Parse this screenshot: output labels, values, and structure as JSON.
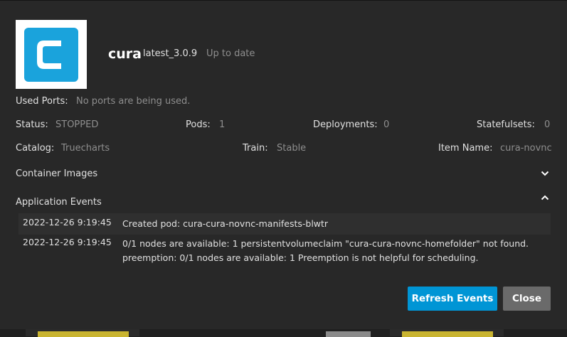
{
  "app": {
    "name": "cura",
    "version": "latest_3.0.9",
    "update_status": "Up to date"
  },
  "details": {
    "used_ports_label": "Used Ports:",
    "used_ports_value": "No ports are being used.",
    "status_label": "Status:",
    "status_value": "STOPPED",
    "pods_label": "Pods:",
    "pods_value": "1",
    "deployments_label": "Deployments:",
    "deployments_value": "0",
    "statefulsets_label": "Statefulsets:",
    "statefulsets_value": "0",
    "catalog_label": "Catalog:",
    "catalog_value": "Truecharts",
    "train_label": "Train:",
    "train_value": "Stable",
    "item_name_label": "Item Name:",
    "item_name_value": "cura-novnc"
  },
  "sections": {
    "container_images": "Container Images",
    "application_events": "Application Events"
  },
  "events": [
    {
      "time": "2022-12-26 9:19:45",
      "message": "Created pod: cura-cura-novnc-manifests-blwtr"
    },
    {
      "time": "2022-12-26 9:19:45",
      "message": "0/1 nodes are available: 1 persistentvolumeclaim \"cura-cura-novnc-homefolder\" not found. preemption: 0/1 nodes are available: 1 Preemption is not helpful for scheduling."
    }
  ],
  "buttons": {
    "refresh": "Refresh Events",
    "close": "Close"
  },
  "colors": {
    "accent": "#0095d5",
    "logo_blue": "#1aa3dc",
    "close_button": "#6a6a6a"
  },
  "icons": {
    "logo": "cura-logo-icon",
    "collapsed": "chevron-down-icon",
    "expanded": "chevron-up-icon"
  }
}
